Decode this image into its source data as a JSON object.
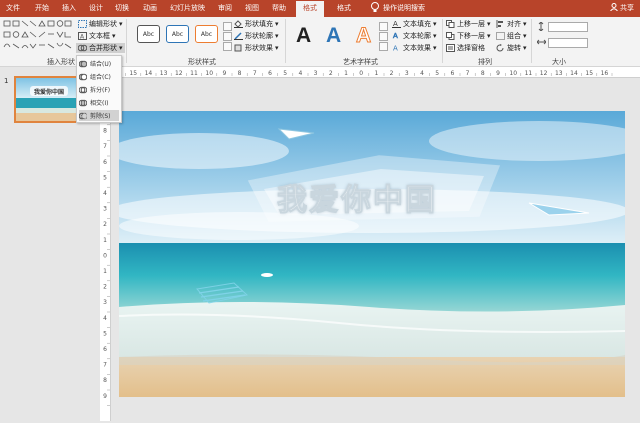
{
  "menu": {
    "tabs": [
      "文件",
      "开始",
      "插入",
      "设计",
      "切换",
      "动画",
      "幻灯片放映",
      "审阅",
      "视图",
      "帮助"
    ],
    "active_tab": "格式",
    "extra_tab": "格式",
    "search": "操作说明搜索",
    "share": "共享"
  },
  "ribbon": {
    "groups": {
      "insert_shapes": "插入形状",
      "shape_styles": "形状样式",
      "wordart_styles": "艺术字样式",
      "arrange": "排列",
      "size": "大小"
    },
    "edit_shape": "编辑形状",
    "text_box": "文本框",
    "merge_shapes": "合并形状",
    "style_sample": "Abc",
    "shape_fill": "形状填充",
    "shape_outline": "形状轮廓",
    "shape_effects": "形状效果",
    "wordart_sample": "A",
    "text_fill": "文本填充",
    "text_outline": "文本轮廓",
    "text_effects": "文本效果",
    "bring_forward": "上移一层",
    "send_backward": "下移一层",
    "selection_pane": "选择窗格",
    "align": "对齐",
    "group": "组合",
    "rotate": "旋转"
  },
  "merge_menu": {
    "items": [
      "结合(U)",
      "组合(C)",
      "拆分(F)",
      "相交(I)",
      "剪除(S)"
    ],
    "highlighted": "剪除(S)"
  },
  "slides": {
    "number": "1",
    "title_text": "我爱你中国"
  },
  "ruler": {
    "h_labels": [
      "16",
      "15",
      "14",
      "13",
      "12",
      "11",
      "10",
      "9",
      "8",
      "7",
      "6",
      "5",
      "4",
      "3",
      "2",
      "1",
      "0",
      "1",
      "2",
      "3",
      "4",
      "5",
      "6",
      "7",
      "8",
      "9",
      "10",
      "11",
      "12",
      "13",
      "14",
      "15",
      "16"
    ],
    "v_labels": [
      "9",
      "8",
      "7",
      "6",
      "5",
      "4",
      "3",
      "2",
      "1",
      "0",
      "1",
      "2",
      "3",
      "4",
      "5",
      "6",
      "7",
      "8",
      "9"
    ]
  },
  "colors": {
    "accent": "#b8442a",
    "thumb_border": "#e0843e",
    "wordart_blue": "#2e75b6",
    "wordart_orange": "#ed7d31"
  }
}
